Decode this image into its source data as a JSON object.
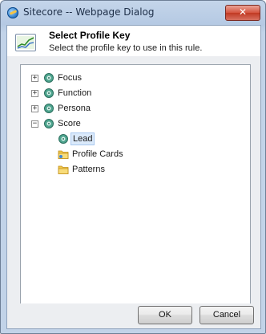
{
  "window": {
    "title": "Sitecore -- Webpage Dialog",
    "close_label": "✕"
  },
  "header": {
    "title": "Select Profile Key",
    "subtitle": "Select the profile key to use in this rule."
  },
  "tree": {
    "nodes": [
      {
        "label": "Focus",
        "icon": "profile-key-icon",
        "expander": "+"
      },
      {
        "label": "Function",
        "icon": "profile-key-icon",
        "expander": "+"
      },
      {
        "label": "Persona",
        "icon": "profile-key-icon",
        "expander": "+"
      },
      {
        "label": "Score",
        "icon": "profile-key-icon",
        "expander": "−"
      },
      {
        "label": "Lead",
        "icon": "profile-key-icon",
        "selected": true
      },
      {
        "label": "Profile Cards",
        "icon": "folder-icon"
      },
      {
        "label": "Patterns",
        "icon": "folder-icon"
      }
    ]
  },
  "footer": {
    "ok_label": "OK",
    "cancel_label": "Cancel"
  },
  "colors": {
    "title_bar": "#b5c9e3",
    "close_button": "#c13a23",
    "selection": "#dbeafb",
    "body_bg": "#eceef1"
  }
}
